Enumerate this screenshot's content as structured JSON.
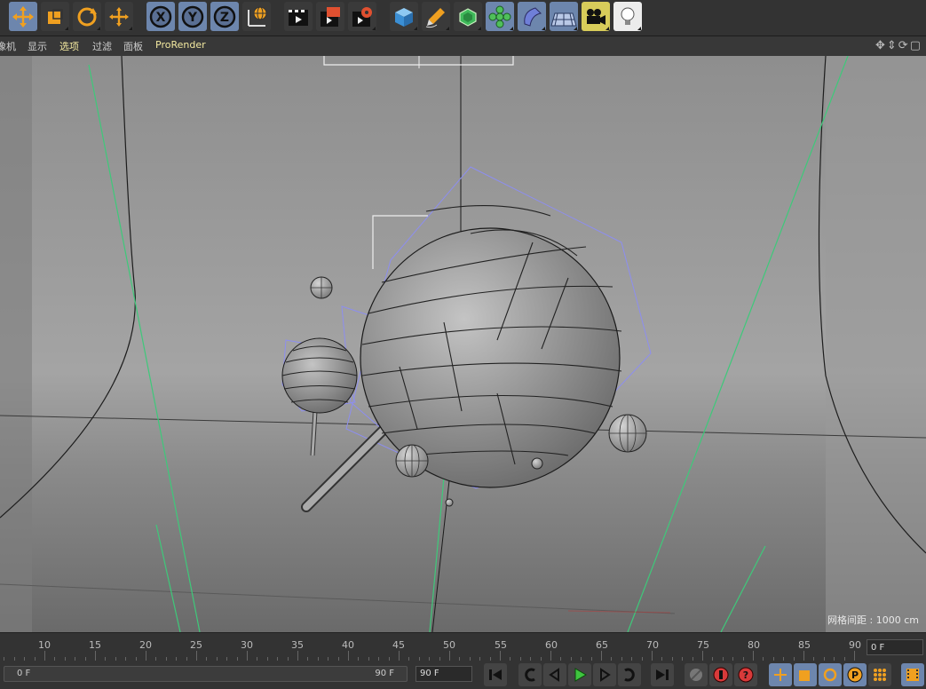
{
  "toolbar": {
    "icons": [
      "move-icon",
      "scale-icon",
      "rotate-icon",
      "live-select-icon",
      "x-axis-lock-icon",
      "y-axis-lock-icon",
      "z-axis-lock-icon",
      "world-coordinates-icon",
      "render-view-icon",
      "render-picture-viewer-icon",
      "render-settings-icon",
      "cube-icon",
      "pen-icon",
      "subdivision-icon",
      "cloner-icon",
      "bend-deformer-icon",
      "floor-icon",
      "camera-icon",
      "light-icon"
    ]
  },
  "menu": {
    "camera": "像机",
    "display": "显示",
    "options": "选项",
    "filter": "过滤",
    "panel": "面板",
    "prorender": "ProRender"
  },
  "viewport": {
    "grid_spacing": "网格间距 : 1000 cm"
  },
  "timeline": {
    "ticks": [
      "10",
      "15",
      "20",
      "25",
      "30",
      "35",
      "40",
      "45",
      "50",
      "55",
      "60",
      "65",
      "70",
      "75",
      "80",
      "85",
      "90"
    ],
    "current_frame": "0 F"
  },
  "transport": {
    "range_start": "0 F",
    "range_end": "90 F",
    "end_frame_field": "90 F"
  },
  "colors": {
    "accent_blue": "#6d86ad",
    "icon_orange": "#f0a020",
    "viewport_bg": "#8f8f8f",
    "menu_active": "#f3e9a0"
  }
}
